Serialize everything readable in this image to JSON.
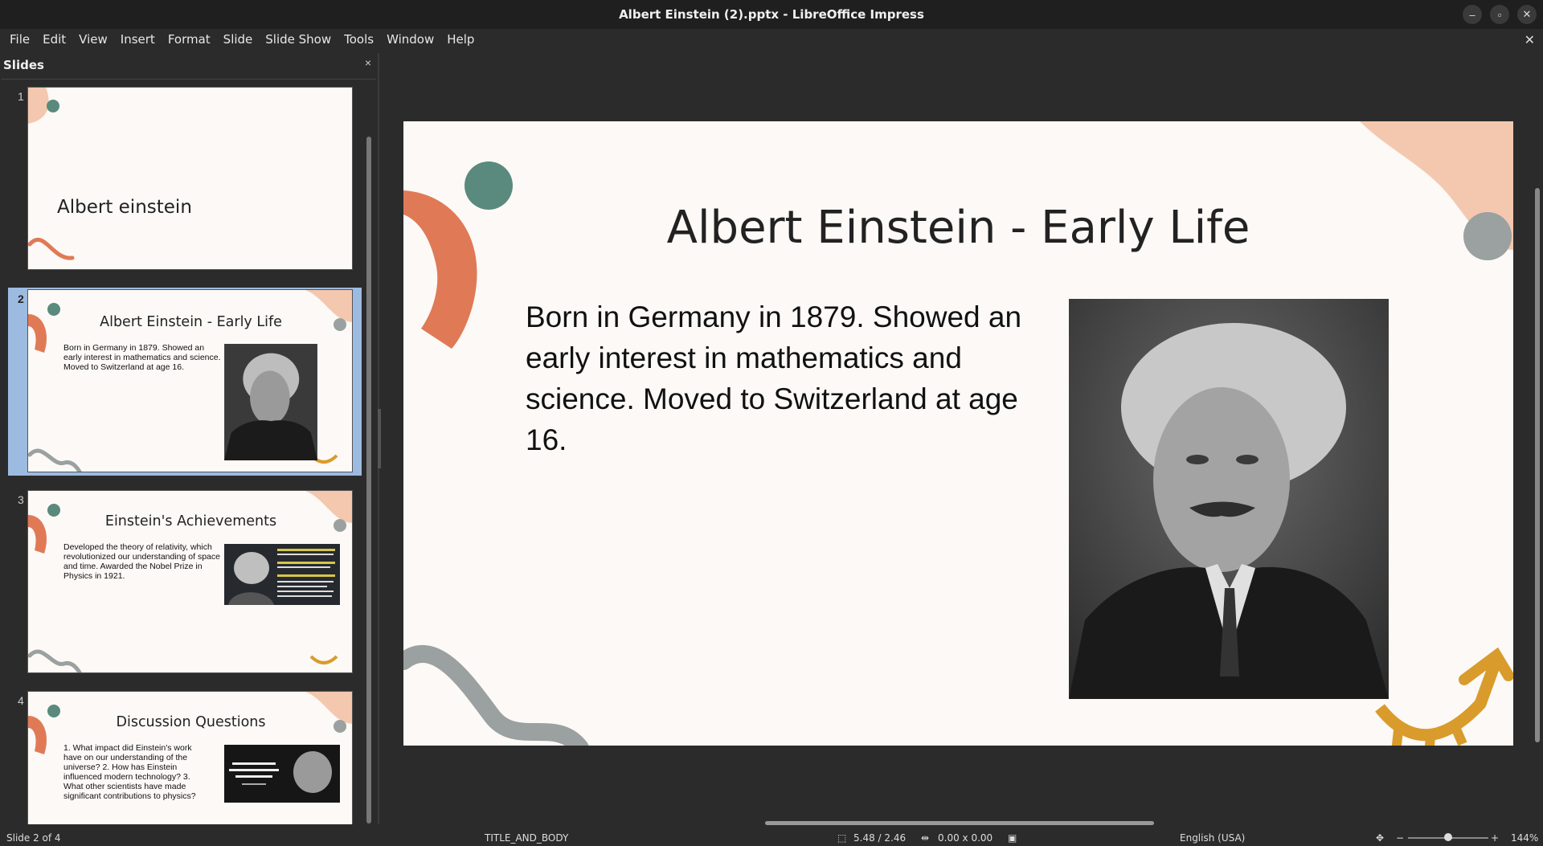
{
  "window": {
    "title": "Albert Einstein (2).pptx - LibreOffice Impress"
  },
  "menu": [
    "File",
    "Edit",
    "View",
    "Insert",
    "Format",
    "Slide",
    "Slide Show",
    "Tools",
    "Window",
    "Help"
  ],
  "sidebar": {
    "title": "Slides",
    "slides": [
      {
        "number": "1",
        "title": "Albert einstein"
      },
      {
        "number": "2",
        "title": "Albert Einstein - Early Life",
        "body": "Born in Germany in 1879. Showed an early interest in mathematics and science. Moved to Switzerland at age 16."
      },
      {
        "number": "3",
        "title": "Einstein's Achievements",
        "body": "Developed the theory of relativity, which revolutionized our understanding of space and time. Awarded the Nobel Prize in Physics in 1921."
      },
      {
        "number": "4",
        "title": "Discussion Questions",
        "body": "1. What impact did Einstein's work have on our understanding of the universe? 2. How has Einstein influenced modern technology? 3. What other scientists have made significant contributions to physics?"
      }
    ],
    "selected": 2
  },
  "editor": {
    "title": "Albert Einstein - Early Life",
    "body": "Born in Germany in 1879. Showed an early interest in mathematics and science. Moved to Switzerland at age 16."
  },
  "status": {
    "slide": "Slide 2 of 4",
    "layout": "TITLE_AND_BODY",
    "position": "5.48 / 2.46",
    "size": "0.00 x 0.00",
    "language": "English (USA)",
    "zoom": "144%",
    "zoom_minus": "−",
    "zoom_plus": "+"
  },
  "colors": {
    "orange": "#e07a56",
    "teal": "#5a8a7d",
    "gray": "#9aa1a0",
    "peach": "#f4c8ae",
    "gold": "#d99b2b",
    "selection": "#9dbbe0"
  }
}
